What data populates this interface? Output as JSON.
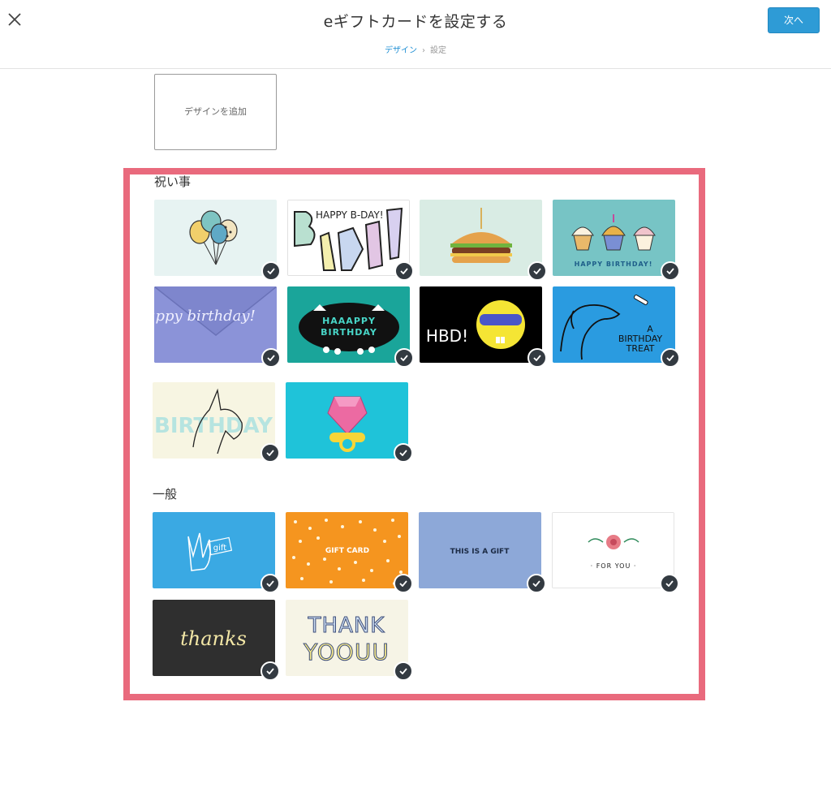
{
  "header": {
    "title": "eギフトカードを設定する",
    "breadcrumb": {
      "active": "デザイン",
      "separator": "›",
      "next": "設定"
    },
    "next_button": "次へ"
  },
  "add_design": {
    "label": "デザインを追加"
  },
  "sections": {
    "celebration": {
      "title": "祝い事"
    },
    "general": {
      "title": "一般"
    }
  },
  "cards": {
    "bday": {
      "text": "HAPPY B-DAY!"
    },
    "cupcakes": {
      "text": "HAPPY BIRTHDAY!"
    },
    "envelope": {
      "text": "happy birthday!"
    },
    "monster": {
      "line1": "HAAAPPY",
      "line2": "BIRTHDAY"
    },
    "hbd": {
      "text": "HBD!"
    },
    "dog": {
      "line1": "A",
      "line2": "BIRTHDAY",
      "line3": "TREAT"
    },
    "unicorn": {
      "text": "BIRTHDAY"
    },
    "gift_hand": {
      "text": "gift"
    },
    "gift_card": {
      "text": "GIFT CARD"
    },
    "this_is_gift": {
      "text": "THIS IS A GIFT"
    },
    "for_you": {
      "text": "· FOR YOU ·"
    },
    "thanks": {
      "text": "thanks"
    },
    "thank_you": {
      "line1": "THANK",
      "line2": "YOOUU"
    }
  },
  "colors": {
    "accent": "#2e9bd6",
    "highlight_border": "#e96a7d",
    "check_badge": "#333a41"
  },
  "icons": {
    "close": "close-icon",
    "check": "check-icon"
  }
}
